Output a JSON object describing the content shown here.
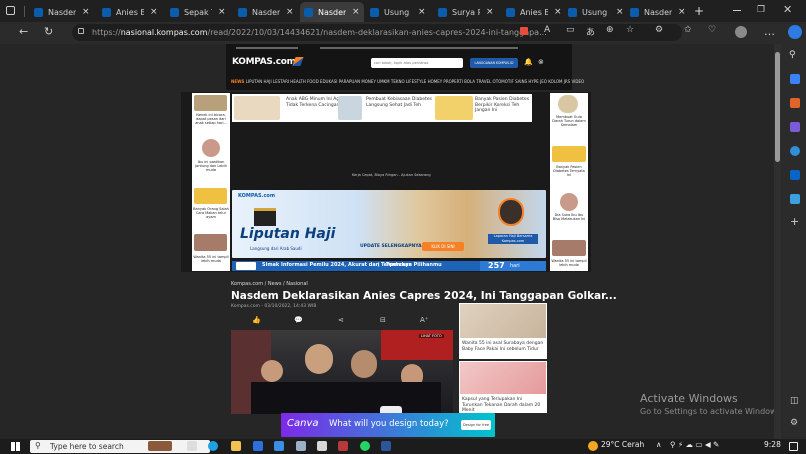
{
  "tabs": [
    {
      "label": "Nasdem",
      "active": false
    },
    {
      "label": "Anies Ba",
      "active": false
    },
    {
      "label": "Sepak Te",
      "active": false
    },
    {
      "label": "Nasdem",
      "active": false
    },
    {
      "label": "Nasdem",
      "active": true
    },
    {
      "label": "Usung A",
      "active": false
    },
    {
      "label": "Surya Pa",
      "active": false
    },
    {
      "label": "Anies Ba",
      "active": false
    },
    {
      "label": "Usung A",
      "active": false
    },
    {
      "label": "Nasdem",
      "active": false
    }
  ],
  "browser": {
    "url_prefix": "https://",
    "url_host": "nasional.kompas.com",
    "url_path": "/read/2022/10/03/14434621/nasdem-deklarasikan-anies-capres-2024-ini-tanggapa...",
    "new_tab": "+",
    "close_tab": "×"
  },
  "site": {
    "logo": "KOMPAS.com",
    "search_placeholder": "cari tokoh, topik atau peristiwa",
    "login_label": "LANGGANAN KOMPAS.ID",
    "menu_highlight": "NEWS",
    "menu": "LIPUTAN HAJI  LESTARI  HEALTH  FOOD  EDUKASI  PARAPUAN  MONEY  UMKM  TEKNO  LIFESTYLE  HOMEY  PROPERTI  BOLA  TRAVEL  OTOMOTIF  SAINS  HYPE  JEO  KOLOM  JRS  VIDEO"
  },
  "ads": {
    "left": [
      "Nenek ini bicara, dapat pesan dari anak setiap hari...",
      "Ibu ini pastikan Jantung dan Lebih muda",
      "Banyak Orang Salah Cara Makan telur ayam",
      "Wanita 55 ini tampil lebih muda"
    ],
    "top": [
      "Anak ABG Minum Ini Agar Tidak Terkena Cacingan",
      "Pembuat Kebiasaan Diabetes Langsung Sehat Jadi Teh",
      "Banyak Pasien Diabetes Berpikir Koreksi Teh Jangan Ini"
    ],
    "right": [
      "Membuat Gula Darah Turun dalam Semalam",
      "Banyak Pasien Diabetes Ternyata Ini",
      "Dia Suka Ibu Ibu Bisa Melakukan Ini",
      "Wanita 55 ini tampil lebih muda"
    ],
    "haji": {
      "brand": "KOMPAS.com",
      "title": "Liputan Haji",
      "subtitle": "Langsung dari Arab Saudi",
      "update": "UPDATE SELENGKAPNYA",
      "cta": "KLIK DI SINI",
      "reporter": "Laporan Haji Bersama Kompas.com"
    },
    "pemilu": {
      "text": "Simak Informasi Pemilu 2024, Akurat dan Terpercaya",
      "sep": "|",
      "text2": "Tentukan Pilihanmu",
      "days": "257",
      "days_label": "hari"
    },
    "small_link": "Kerja Cepat, Biaya Ringan - Ajukan Sekarang"
  },
  "article": {
    "breadcrumb": "Kompas.com / News / Nasional",
    "title": "Nasdem Deklarasikan Anies Capres 2024, Ini Tanggapan Golkar...",
    "date": "Kompas.com - 03/10/2022, 14:43 WIB",
    "photo_tag": "LIHAT FOTO",
    "side_ads": [
      "Wanita 55 ini asal Surabaya dengan Baby Face Pakai Ini sebelum Tidur",
      "Kapsul yang Terlupakan Ini Turunkan Tekanan Darah dalam 20 Menit"
    ]
  },
  "canva": {
    "brand": "Canva",
    "text": "What will you design today?",
    "cta": "Design for free"
  },
  "windows": {
    "activate_title": "Activate Windows",
    "activate_sub": "Go to Settings to activate Windows.",
    "search_placeholder": "Type here to search",
    "weather": "29°C  Cerah",
    "time": "9:28"
  }
}
